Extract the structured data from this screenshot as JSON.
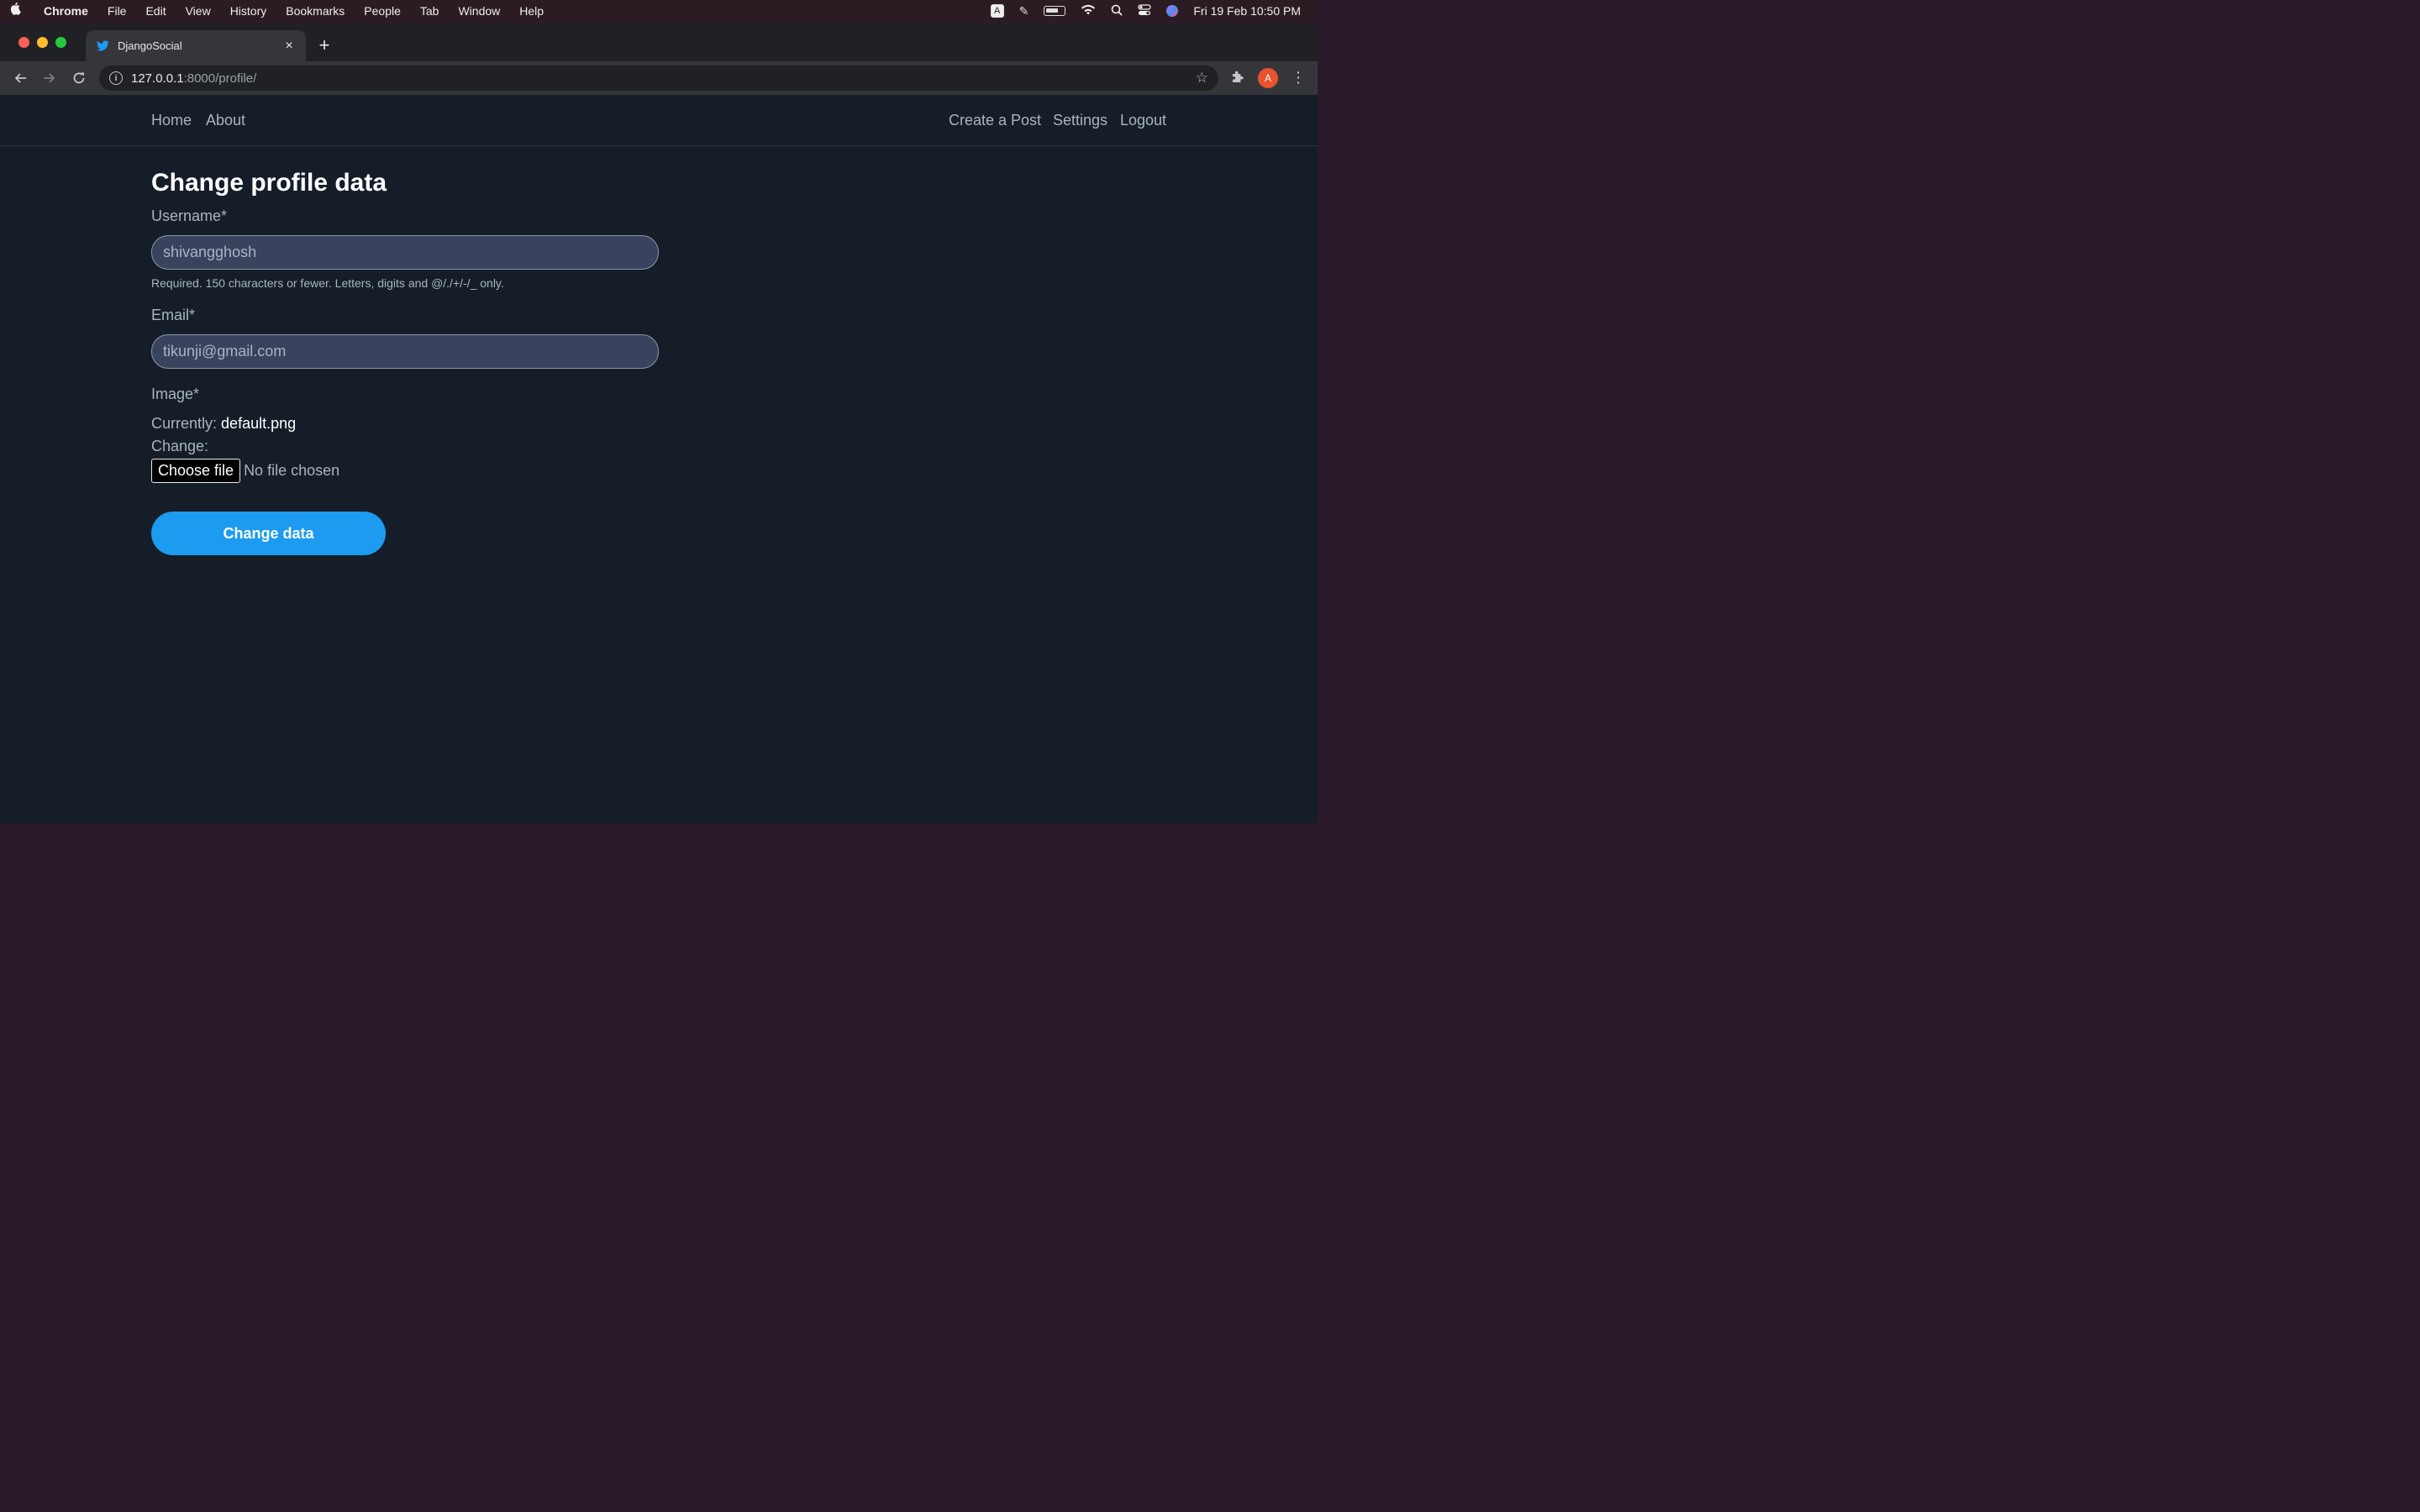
{
  "menubar": {
    "apple": "",
    "app": "Chrome",
    "items": [
      "File",
      "Edit",
      "View",
      "History",
      "Bookmarks",
      "People",
      "Tab",
      "Window",
      "Help"
    ],
    "input_indicator": "A",
    "datetime": "Fri 19 Feb  10:50 PM"
  },
  "browser": {
    "tab_title": "DjangoSocial",
    "tab_close": "×",
    "new_tab": "+",
    "url_host": "127.0.0.1",
    "url_path": ":8000/profile/",
    "avatar_letter": "A"
  },
  "nav": {
    "left": [
      "Home",
      "About"
    ],
    "right": [
      "Create a Post",
      "Settings",
      "Logout"
    ]
  },
  "form": {
    "title": "Change profile data",
    "username_label": "Username*",
    "username_value": "shivangghosh",
    "username_help": "Required. 150 characters or fewer. Letters, digits and @/./+/-/_ only.",
    "email_label": "Email*",
    "email_value": "tikunji@gmail.com",
    "image_label": "Image*",
    "currently_label": "Currently:",
    "currently_value": "default.png",
    "change_label": "Change:",
    "choose_file": "Choose file",
    "no_file": "No file chosen",
    "submit": "Change data"
  },
  "colors": {
    "page_bg": "#151e28",
    "accent": "#1d9bf0",
    "input_bg": "#39435e"
  }
}
